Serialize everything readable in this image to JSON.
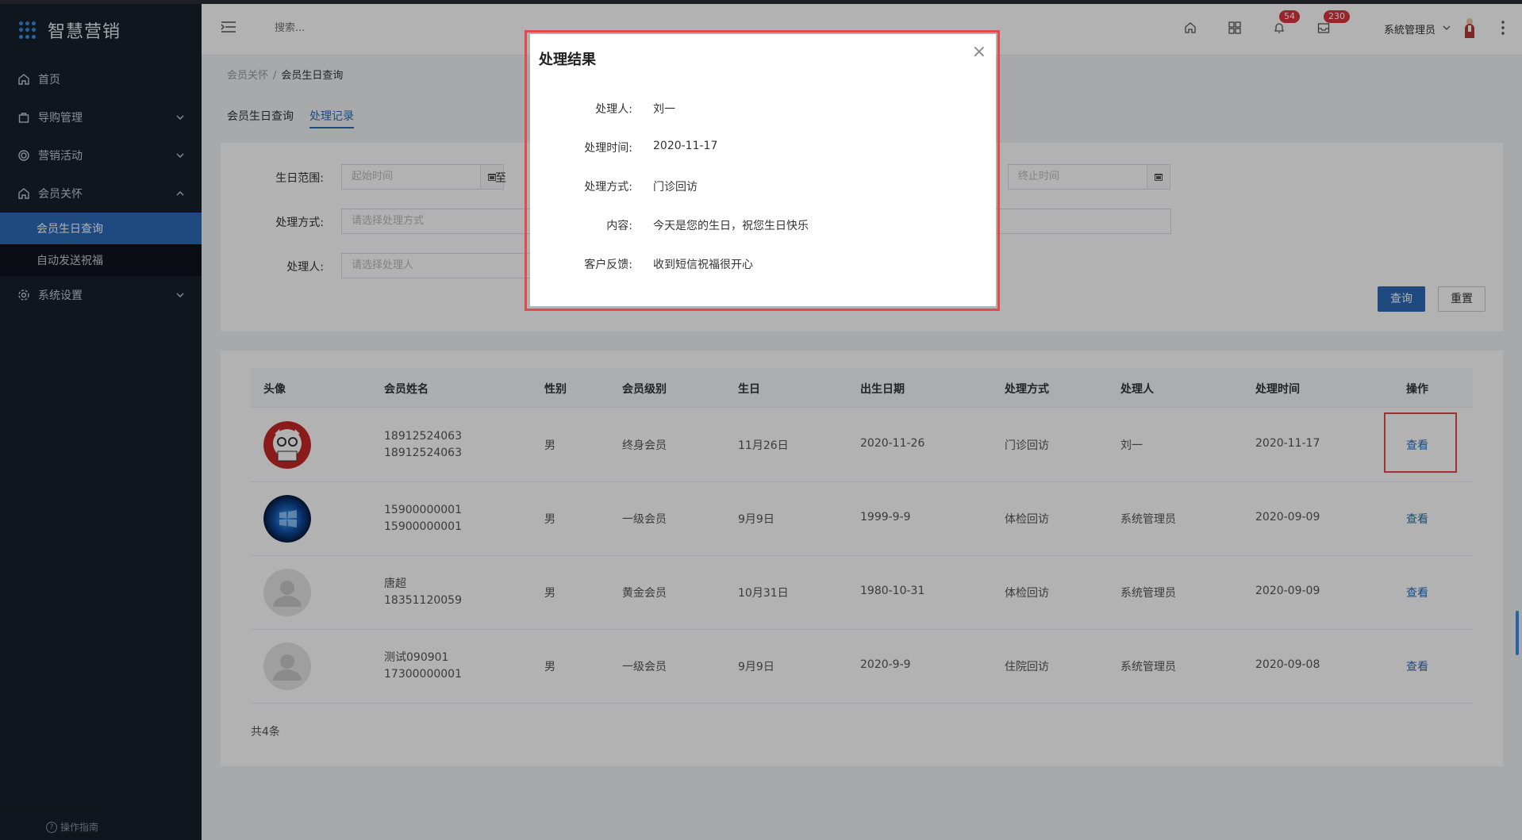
{
  "app": {
    "title": "智慧营销"
  },
  "sidebar": {
    "items": [
      {
        "label": "首页",
        "icon": "home-icon"
      },
      {
        "label": "导购管理",
        "icon": "bag-icon"
      },
      {
        "label": "营销活动",
        "icon": "target-icon"
      },
      {
        "label": "会员关怀",
        "icon": "home-icon"
      },
      {
        "label": "系统设置",
        "icon": "gear-icon"
      }
    ],
    "sub_items": [
      {
        "label": "会员生日查询"
      },
      {
        "label": "自动发送祝福"
      }
    ],
    "guide": "操作指南"
  },
  "header": {
    "search_placeholder": "搜索...",
    "notifications_count": "54",
    "messages_count": "230",
    "user_name": "系統管理员"
  },
  "breadcrumb": {
    "parent": "会员关怀",
    "current": "会员生日查询"
  },
  "tabs": [
    {
      "label": "会员生日查询"
    },
    {
      "label": "处理记录"
    }
  ],
  "filters": {
    "birthday_label": "生日范围:",
    "start_placeholder": "起始时间",
    "to_label": "至",
    "end_placeholder": "终止时间",
    "method_label": "处理方式:",
    "method_placeholder": "请选择处理方式",
    "handler_label": "处理人:",
    "handler_placeholder": "请选择处理人",
    "query_button": "查询",
    "reset_button": "重置"
  },
  "table": {
    "columns": [
      "头像",
      "会员姓名",
      "性别",
      "会员级别",
      "生日",
      "出生日期",
      "处理方式",
      "处理人",
      "处理时间",
      "操作"
    ],
    "rows": [
      {
        "name": "18912524063",
        "phone": "18912524063",
        "gender": "男",
        "level": "终身会员",
        "birthday": "11月26日",
        "birth_date": "2020-11-26",
        "method": "门诊回访",
        "handler": "刘一",
        "time": "2020-11-17",
        "action": "查看",
        "avatar": "cartoon-avatar"
      },
      {
        "name": "15900000001",
        "phone": "15900000001",
        "gender": "男",
        "level": "一级会员",
        "birthday": "9月9日",
        "birth_date": "1999-9-9",
        "method": "体检回访",
        "handler": "系统管理员",
        "time": "2020-09-09",
        "action": "查看",
        "avatar": "windows-avatar"
      },
      {
        "name": "唐超",
        "phone": "18351120059",
        "gender": "男",
        "level": "黄金会员",
        "birthday": "10月31日",
        "birth_date": "1980-10-31",
        "method": "体检回访",
        "handler": "系统管理员",
        "time": "2020-09-09",
        "action": "查看",
        "avatar": "default-avatar"
      },
      {
        "name": "测试090901",
        "phone": "17300000001",
        "gender": "男",
        "level": "一级会员",
        "birthday": "9月9日",
        "birth_date": "2020-9-9",
        "method": "住院回访",
        "handler": "系统管理员",
        "time": "2020-09-08",
        "action": "查看",
        "avatar": "default-avatar"
      }
    ],
    "total": "共4条"
  },
  "modal": {
    "title": "处理结果",
    "close": "×",
    "fields": [
      {
        "label": "处理人:",
        "value": "刘一"
      },
      {
        "label": "处理时间:",
        "value": "2020-11-17"
      },
      {
        "label": "处理方式:",
        "value": "门诊回访"
      },
      {
        "label": "内容:",
        "value": "今天是您的生日，祝您生日快乐"
      },
      {
        "label": "客户反馈:",
        "value": "收到短信祝福很开心"
      }
    ]
  },
  "colors": {
    "sidebar_bg": "#17202c",
    "accent": "#2d6bb6",
    "highlight": "#e5484d",
    "badge": "#d9363e"
  }
}
